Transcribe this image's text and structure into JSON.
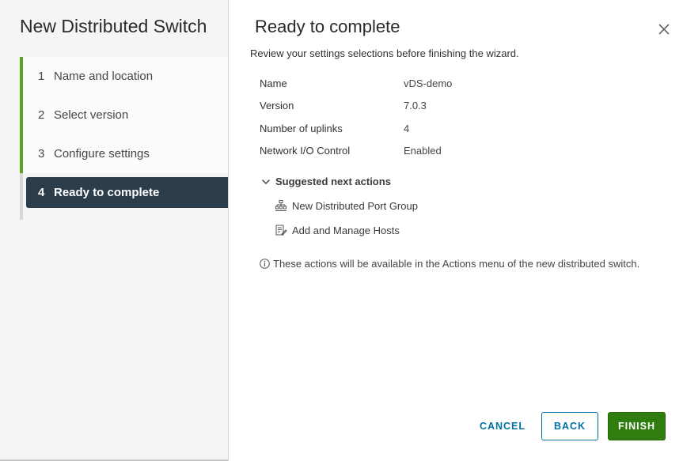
{
  "wizard": {
    "title": "New Distributed Switch",
    "steps": [
      {
        "number": "1",
        "label": "Name and location"
      },
      {
        "number": "2",
        "label": "Select version"
      },
      {
        "number": "3",
        "label": "Configure settings"
      },
      {
        "number": "4",
        "label": "Ready to complete"
      }
    ],
    "active_step": 4
  },
  "page": {
    "title": "Ready to complete",
    "subtitle": "Review your settings selections before finishing the wizard.",
    "close_icon": "close-icon"
  },
  "summary": [
    {
      "key": "Name",
      "value": "vDS-demo"
    },
    {
      "key": "Version",
      "value": "7.0.3"
    },
    {
      "key": "Number of uplinks",
      "value": "4"
    },
    {
      "key": "Network I/O Control",
      "value": "Enabled"
    }
  ],
  "suggested": {
    "heading": "Suggested next actions",
    "actions": [
      {
        "label": "New Distributed Port Group",
        "icon": "port-group-icon"
      },
      {
        "label": "Add and Manage Hosts",
        "icon": "manage-hosts-icon"
      }
    ]
  },
  "note": "These actions will be available in the Actions menu of the new distributed switch.",
  "footer": {
    "cancel_label": "CANCEL",
    "back_label": "BACK",
    "finish_label": "FINISH"
  },
  "colors": {
    "step_done": "#5aa220",
    "step_active_bg": "#2b3d4b",
    "link_blue": "#0072a3",
    "finish_green": "#2e7d0e"
  }
}
